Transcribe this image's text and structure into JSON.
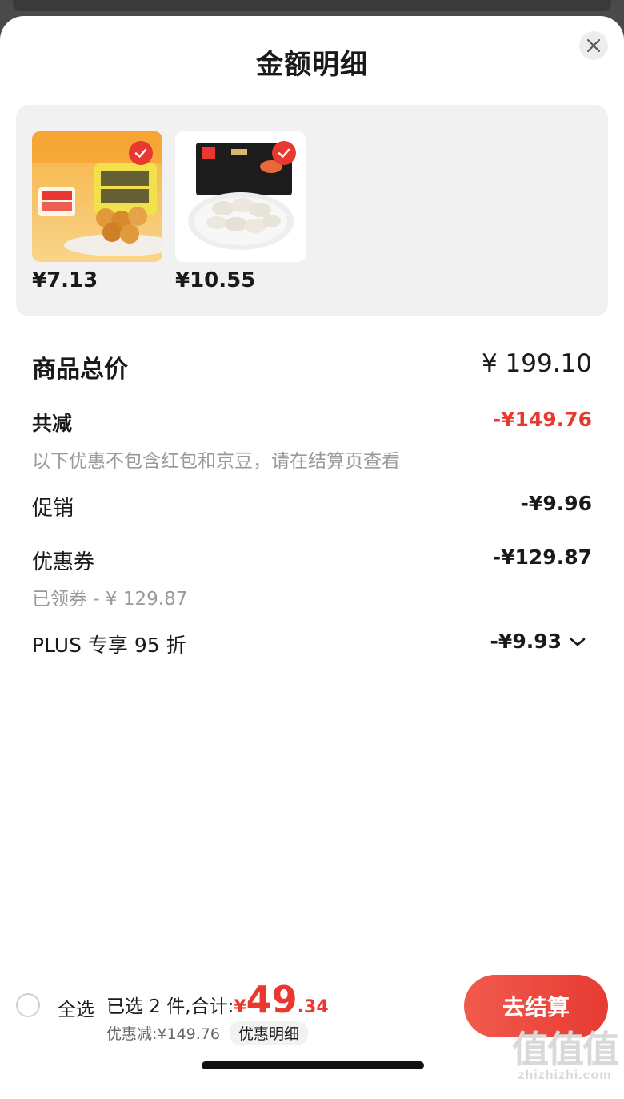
{
  "sheet": {
    "title": "金额明细"
  },
  "products": [
    {
      "price": "¥7.13",
      "checked": true
    },
    {
      "price": "¥10.55",
      "checked": true
    }
  ],
  "summary": {
    "total_label": "商品总价",
    "total_value": "¥ 199.10",
    "reduction_label": "共减",
    "reduction_value": "-¥149.76",
    "reduction_note": "以下优惠不包含红包和京豆，请在结算页查看",
    "promo_label": "促销",
    "promo_value": "-¥9.96",
    "coupon_label": "优惠券",
    "coupon_value": "-¥129.87",
    "coupon_note": "已领券 - ¥ 129.87",
    "plus_label": "PLUS 专享 95 折",
    "plus_value": "-¥9.93"
  },
  "bottom_bar": {
    "select_all": "全选",
    "selected_text": "已选 2 件,合计:",
    "currency": "¥",
    "total_int": "49",
    "total_dec": ".34",
    "discount_text": "优惠减:¥149.76",
    "details_label": "优惠明细",
    "checkout_label": "去结算"
  },
  "colors": {
    "accent": "#e8382f",
    "panel_bg": "#f1f1f1"
  },
  "watermark": {
    "logo": "值值值",
    "url": "zhizhizhi.com"
  }
}
